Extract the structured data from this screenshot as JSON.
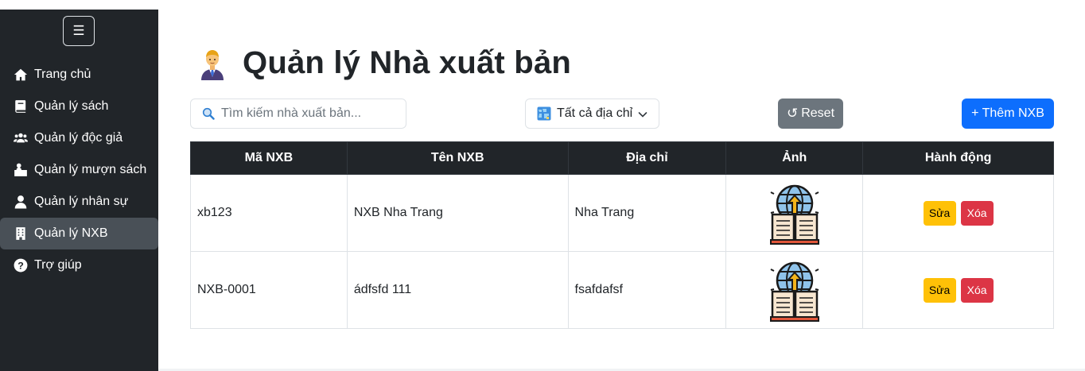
{
  "sidebar": {
    "toggle_icon": "☰",
    "items": [
      {
        "label": "Trang chủ",
        "icon": "home-icon"
      },
      {
        "label": "Quản lý sách",
        "icon": "book-icon"
      },
      {
        "label": "Quản lý độc giả",
        "icon": "users-icon"
      },
      {
        "label": "Quản lý mượn sách",
        "icon": "person-box-icon"
      },
      {
        "label": "Quản lý nhân sự",
        "icon": "user-icon"
      },
      {
        "label": "Quản lý NXB",
        "icon": "building-icon",
        "active": true
      },
      {
        "label": "Trợ giúp",
        "icon": "question-icon"
      }
    ]
  },
  "page": {
    "title": "Quản lý Nhà xuất bản",
    "title_icon": "office-worker-icon"
  },
  "toolbar": {
    "search_placeholder": "Tìm kiếm nhà xuất bản...",
    "address_filter": "Tất cả địa chỉ",
    "reset_label": "Reset",
    "reset_icon": "↺",
    "add_label": "+ Thêm NXB"
  },
  "table": {
    "headers": [
      "Mã NXB",
      "Tên NXB",
      "Địa chỉ",
      "Ảnh",
      "Hành động"
    ],
    "rows": [
      {
        "code": "xb123",
        "name": "NXB Nha Trang",
        "address": "Nha Trang",
        "image": "globe-book-icon"
      },
      {
        "code": "NXB-0001",
        "name": "ádfsfd 111",
        "address": "fsafdafsf",
        "image": "globe-book-icon"
      }
    ],
    "edit_label": "Sửa",
    "delete_label": "Xóa"
  },
  "colors": {
    "sidebar_bg": "#212529",
    "active_item": "#495057",
    "primary": "#0d6efd",
    "secondary": "#6c757d",
    "warning": "#ffc107",
    "danger": "#dc3545"
  }
}
